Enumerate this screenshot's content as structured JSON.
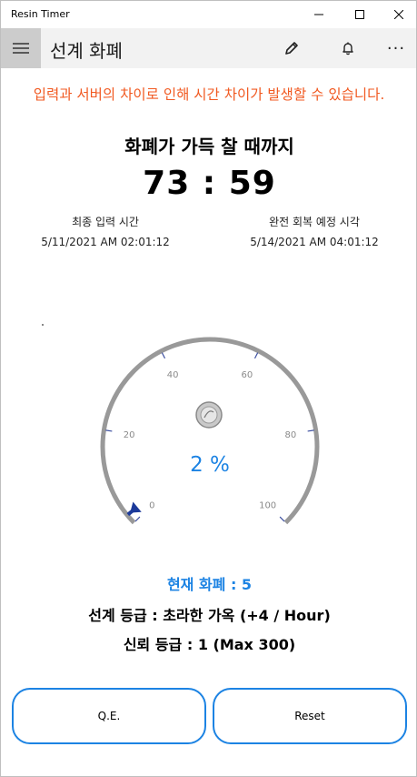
{
  "window": {
    "title": "Resin Timer"
  },
  "appbar": {
    "title": "선계 화폐",
    "icons": [
      "hamburger-icon",
      "pencil-icon",
      "bell-icon",
      "more-icon"
    ],
    "more_glyph": "···"
  },
  "warning": "입력과 서버의 차이로 인해 시간 차이가 발생할 수 있습니다.",
  "until_full_label": "화폐가 가득 찰 때까지",
  "timer": "73 : 59",
  "last_input": {
    "label": "최종 입력 시간",
    "value": "5/11/2021 AM 02:01:12"
  },
  "full_recovery": {
    "label": "완전 회복 예정 시각",
    "value": "5/14/2021 AM 04:01:12"
  },
  "gauge": {
    "min": 0,
    "max": 100,
    "value_percent": 2,
    "display": "2 %",
    "tick_labels": [
      "0",
      "20",
      "40",
      "60",
      "80",
      "100"
    ],
    "needle_color": "#1c3a9a",
    "accent_color": "#1c83e3"
  },
  "current_resin": "현재 화폐 : 5",
  "world_rank": "선계 등급 : 초라한 가옥 (+4 / Hour)",
  "trust_rank": "신뢰 등급 : 1 (Max 300)",
  "buttons": {
    "qe": "Q.E.",
    "reset": "Reset"
  },
  "colors": {
    "warning": "#f15a22",
    "accent": "#1c83e3"
  }
}
